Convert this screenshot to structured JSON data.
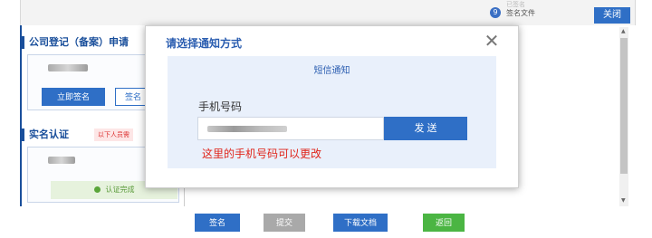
{
  "background": {
    "top_bar": {
      "signed_faint": "已签名",
      "signature_file_num": "9",
      "signature_file_label": "签名文件",
      "close_label": "关闭"
    },
    "section_company": {
      "title": "公司登记（备案）申请",
      "sign_now_label": "立即签名",
      "sign_label": "签名"
    },
    "section_realname": {
      "title": "实名认证",
      "tag": "以下人员需",
      "verified_label": "认证完成"
    },
    "bottom_buttons": {
      "sign": "签名",
      "submit": "提交",
      "download": "下载文档",
      "back": "返回"
    },
    "colors": {
      "primary": "#2f6fc6",
      "submit_disabled": "#a9a9a9",
      "back": "#4bb543"
    }
  },
  "dialog": {
    "title": "请选择通知方式",
    "close_icon": "close-icon",
    "tab": "短信通知",
    "phone_label": "手机号码",
    "phone_value": "",
    "send_label": "发 送",
    "note": "这里的手机号码可以更改",
    "note_color": "#e0251b"
  }
}
